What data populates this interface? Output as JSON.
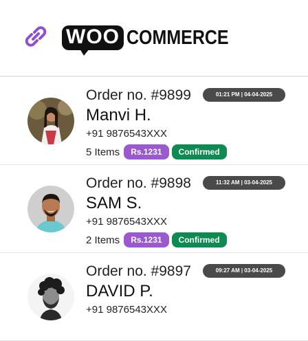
{
  "header": {
    "logo_woo": "WOO",
    "logo_commerce": "COMMERCE",
    "icon": "link-icon"
  },
  "colors": {
    "price_badge": "#9b59d0",
    "status_confirmed": "#0e8a52",
    "timestamp_badge": "#4a4a4a",
    "link_icon": "#8e4fd0"
  },
  "orders": [
    {
      "order_no": "Order no. #9899",
      "timestamp": "01:21 PM | 04-04-2025",
      "name": "Manvi H.",
      "phone": "+91 9876543XXX",
      "items": "5 Items",
      "price": "Rs.1231",
      "status": "Confirmed"
    },
    {
      "order_no": "Order no. #9898",
      "timestamp": "11:32 AM | 03-04-2025",
      "name": "SAM S.",
      "phone": "+91 9876543XXX",
      "items": "2 Items",
      "price": "Rs.1231",
      "status": "Confirmed"
    },
    {
      "order_no": "Order no. #9897",
      "timestamp": "09:27 AM | 03-04-2025",
      "name": "DAVID P.",
      "phone": "+91 9876543XXX"
    }
  ]
}
